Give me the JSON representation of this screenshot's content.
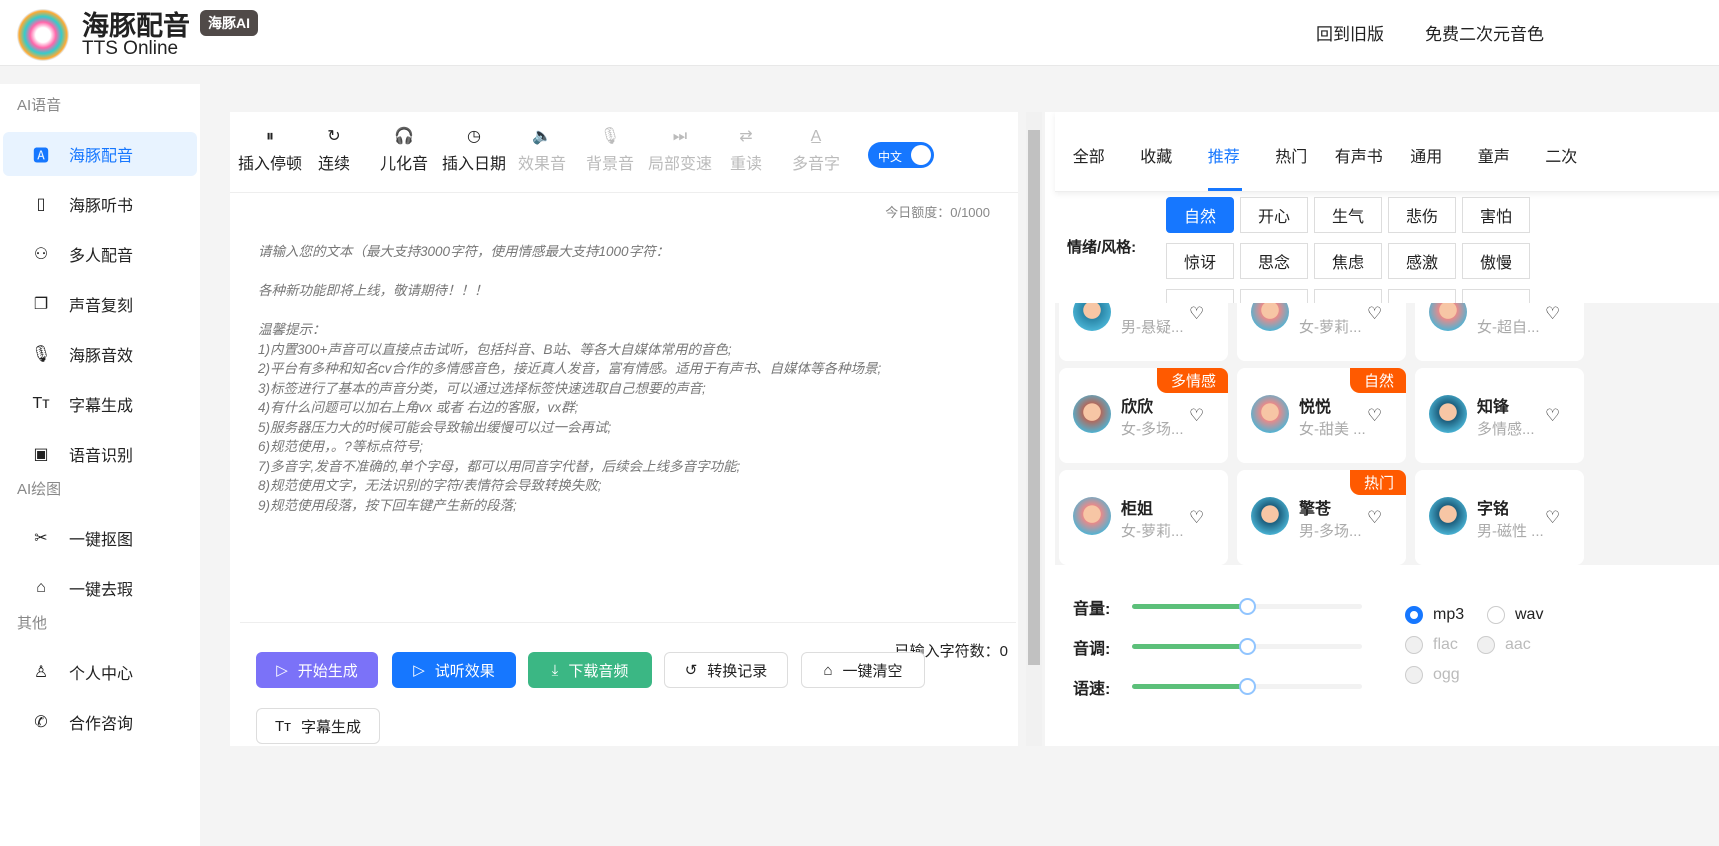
{
  "header": {
    "title": "海豚配音",
    "badge": "海豚AI",
    "subtitle": "TTS Online",
    "links": [
      "回到旧版",
      "免费二次元音色"
    ]
  },
  "sidebar": {
    "sections": [
      {
        "title": "AI语音",
        "items": [
          {
            "label": "海豚配音",
            "icon": "text-voice-icon",
            "active": true
          },
          {
            "label": "海豚听书",
            "icon": "phone-icon"
          },
          {
            "label": "多人配音",
            "icon": "users-add-icon"
          },
          {
            "label": "声音复刻",
            "icon": "copy-icon"
          },
          {
            "label": "海豚音效",
            "icon": "microphone-icon"
          },
          {
            "label": "字幕生成",
            "icon": "text-size-icon"
          },
          {
            "label": "语音识别",
            "icon": "recognize-icon"
          }
        ]
      },
      {
        "title": "AI绘图",
        "items": [
          {
            "label": "一键抠图",
            "icon": "scissors-icon"
          },
          {
            "label": "一键去瑕",
            "icon": "eraser-icon"
          }
        ]
      },
      {
        "title": "其他",
        "items": [
          {
            "label": "个人中心",
            "icon": "user-icon"
          },
          {
            "label": "合作咨询",
            "icon": "phone-call-icon"
          }
        ]
      }
    ]
  },
  "toolbar": {
    "items": [
      {
        "label": "插入停顿",
        "icon": "pause-circle-icon"
      },
      {
        "label": "连续",
        "icon": "redo-icon"
      },
      {
        "label": "儿化音",
        "icon": "headphones-icon"
      },
      {
        "label": "插入日期",
        "icon": "clock-icon"
      },
      {
        "label": "效果音",
        "icon": "speaker-icon",
        "disabled": true
      },
      {
        "label": "背景音",
        "icon": "microphone-icon",
        "disabled": true
      },
      {
        "label": "局部变速",
        "icon": "fast-forward-icon",
        "disabled": true
      },
      {
        "label": "重读",
        "icon": "repeat-icon",
        "disabled": true
      },
      {
        "label": "多音字",
        "icon": "font-a-icon",
        "disabled": true
      }
    ],
    "lang_toggle": "中文"
  },
  "editor": {
    "quota": "今日额度：0/1000",
    "placeholder": "请输入您的文本（最大支持3000字符，使用情感最大支持1000字符：\n\n各种新功能即将上线，敬请期待！！！\n\n温馨提示：\n1)内置300+声音可以直接点击试听，包括抖音、B站、等各大自媒体常用的音色;\n2)平台有多种和知名cv合作的多情感音色，接近真人发音，富有情感。适用于有声书、自媒体等各种场景;\n3)标签进行了基本的声音分类，可以通过选择标签快速选取自己想要的声音;\n4)有什么问题可以加右上角vx 或者 右边的客服，vx群;\n5)服务器压力大的时候可能会导致输出缓慢可以过一会再试;\n6)规范使用，。?等标点符号;\n7)多音字,发音不准确的,单个字母，都可以用同音字代替，后续会上线多音字功能;\n8)规范使用文字，无法识别的字符/表情符会导致转换失败;\n9)规范使用段落，按下回车键产生新的段落;",
    "char_count": "已输入字符数：0"
  },
  "actions": [
    {
      "label": "开始生成",
      "icon": "play-circle-icon",
      "color": "#7b72f8"
    },
    {
      "label": "试听效果",
      "icon": "play-circle-icon",
      "color": "#1677ff"
    },
    {
      "label": "下载音频",
      "icon": "download-icon",
      "color": "#3bb784"
    },
    {
      "label": "转换记录",
      "icon": "history-icon"
    },
    {
      "label": "一键清空",
      "icon": "eraser-icon"
    },
    {
      "label": "字幕生成",
      "icon": "text-size-icon"
    }
  ],
  "voice_tabs": {
    "items": [
      "全部",
      "收藏",
      "推荐",
      "热门",
      "有声书",
      "通用",
      "童声",
      "二次"
    ],
    "active": "推荐"
  },
  "emotion": {
    "label": "情绪/风格:",
    "tags": [
      "自然",
      "开心",
      "生气",
      "悲伤",
      "害怕",
      "惊讶",
      "思念",
      "焦虑",
      "感激",
      "傲慢"
    ],
    "active": "自然"
  },
  "voices": [
    {
      "name": "",
      "desc": "男-悬疑...",
      "avatar": "#2a86a8"
    },
    {
      "name": "",
      "desc": "女-萝莉...",
      "avatar": "#e88a8a"
    },
    {
      "name": "",
      "desc": "女-超自...",
      "avatar": "#e88a8a"
    },
    {
      "name": "欣欣",
      "desc": "女-多场...",
      "tag": "多情感",
      "avatar": "#b06a5e"
    },
    {
      "name": "悦悦",
      "desc": "女-甜美 ...",
      "tag": "自然",
      "avatar": "#e88a8a"
    },
    {
      "name": "知锋",
      "desc": "多情感...",
      "avatar": "#1d5f7e"
    },
    {
      "name": "柜姐",
      "desc": "女-萝莉...",
      "avatar": "#e88a8a"
    },
    {
      "name": "擎苍",
      "desc": "男-多场...",
      "tag": "热门",
      "avatar": "#1d5f7e"
    },
    {
      "name": "字铭",
      "desc": "男-磁性 ...",
      "avatar": "#1d5f7e"
    }
  ],
  "settings": {
    "sliders": [
      {
        "label": "音量:",
        "value": 50
      },
      {
        "label": "音调:",
        "value": 50
      },
      {
        "label": "语速:",
        "value": 50
      }
    ],
    "formats": [
      {
        "label": "mp3",
        "checked": true
      },
      {
        "label": "wav"
      },
      {
        "label": "flac",
        "disabled": true
      },
      {
        "label": "aac",
        "disabled": true
      },
      {
        "label": "ogg",
        "disabled": true
      }
    ]
  },
  "colors": {
    "primary": "#1677ff",
    "tag": "#ff5a00",
    "slider": "#5cc07a"
  }
}
